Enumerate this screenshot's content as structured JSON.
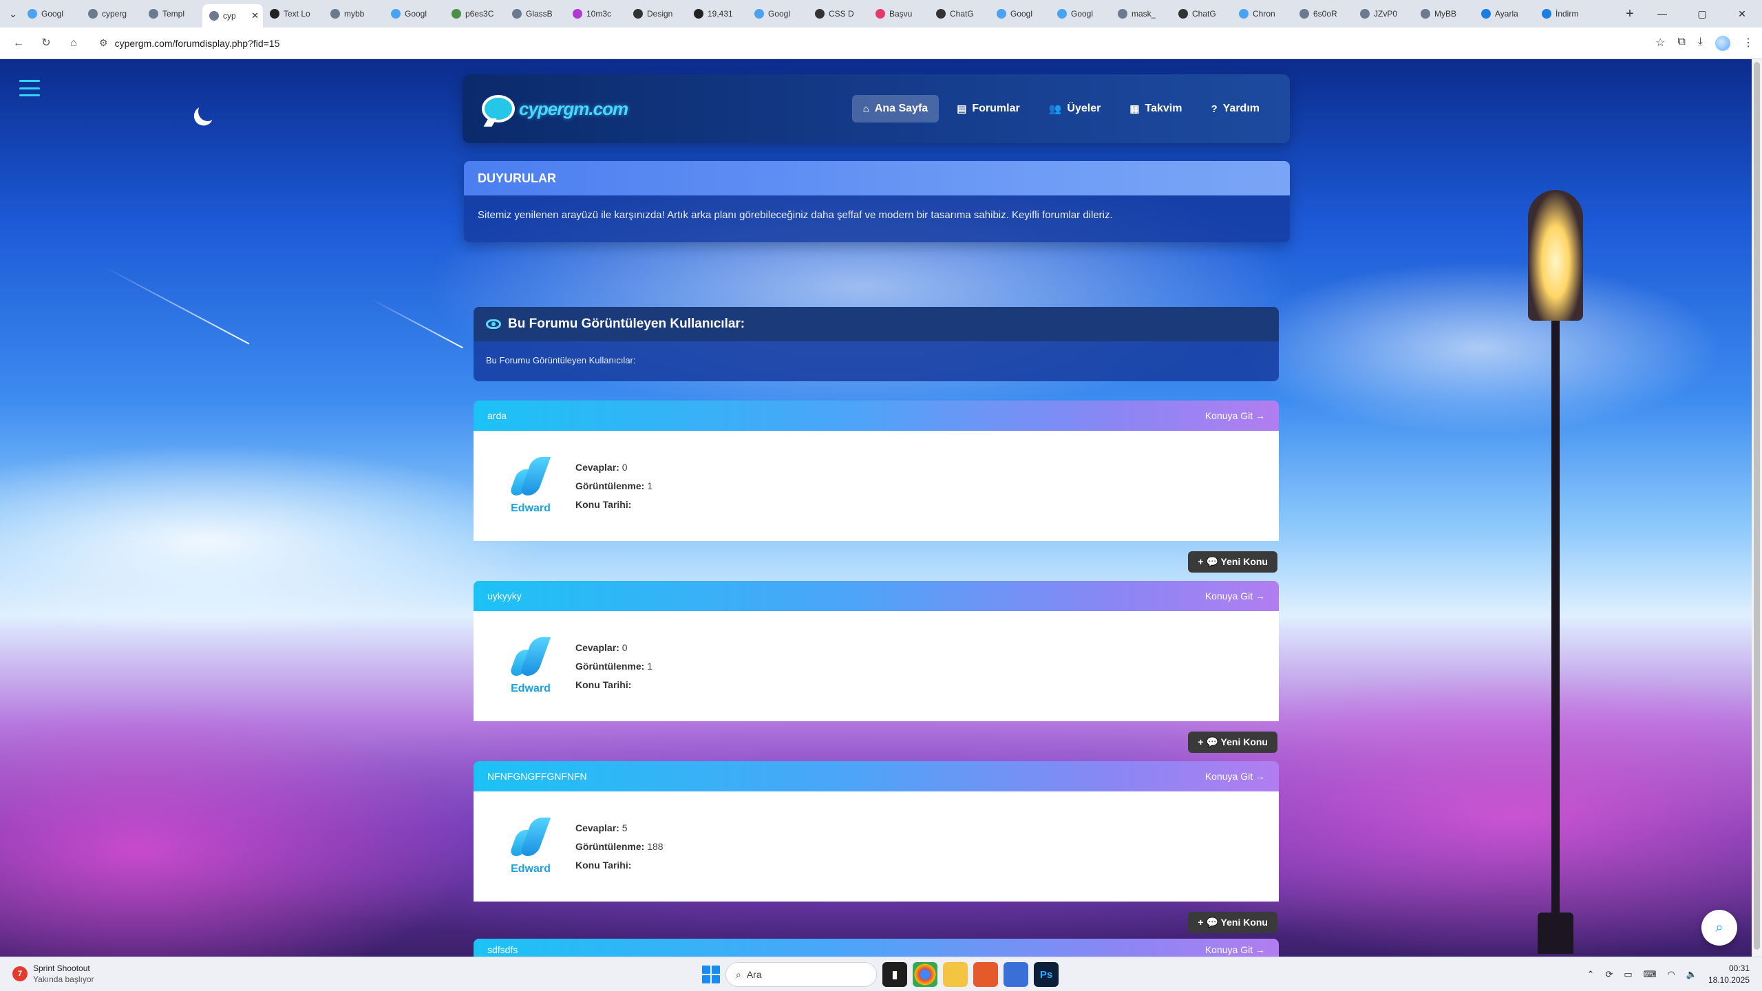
{
  "browser": {
    "tabs": [
      {
        "label": "Googl",
        "color": "#4aa3f0",
        "active": false
      },
      {
        "label": "cyperg",
        "color": "#6c7a90",
        "active": false
      },
      {
        "label": "Templ",
        "color": "#6c7a90",
        "active": false
      },
      {
        "label": "cyp",
        "color": "#6c7a90",
        "active": true
      },
      {
        "label": "Text Lo",
        "color": "#222222",
        "active": false
      },
      {
        "label": "mybb",
        "color": "#6c7a90",
        "active": false
      },
      {
        "label": "Googl",
        "color": "#4aa3f0",
        "active": false
      },
      {
        "label": "p6es3C",
        "color": "#4a8f4a",
        "active": false
      },
      {
        "label": "GlassB",
        "color": "#6c7a90",
        "active": false
      },
      {
        "label": "10m3c",
        "color": "#b03ad0",
        "active": false
      },
      {
        "label": "Design",
        "color": "#333333",
        "active": false
      },
      {
        "label": "19,431",
        "color": "#222222",
        "active": false
      },
      {
        "label": "Googl",
        "color": "#4aa3f0",
        "active": false
      },
      {
        "label": "CSS D",
        "color": "#333333",
        "active": false
      },
      {
        "label": "Başvu",
        "color": "#e33a6a",
        "active": false
      },
      {
        "label": "ChatG",
        "color": "#333333",
        "active": false
      },
      {
        "label": "Googl",
        "color": "#4aa3f0",
        "active": false
      },
      {
        "label": "Googl",
        "color": "#4aa3f0",
        "active": false
      },
      {
        "label": "mask_",
        "color": "#6c7a90",
        "active": false
      },
      {
        "label": "ChatG",
        "color": "#333333",
        "active": false
      },
      {
        "label": "Chron",
        "color": "#4aa3f0",
        "active": false
      },
      {
        "label": "6s0oR",
        "color": "#6c7a90",
        "active": false
      },
      {
        "label": "JZvP0",
        "color": "#6c7a90",
        "active": false
      },
      {
        "label": "MyBB",
        "color": "#6c7a90",
        "active": false
      },
      {
        "label": "Ayarla",
        "color": "#1a7de0",
        "active": false
      },
      {
        "label": "İndirm",
        "color": "#1a7de0",
        "active": false
      }
    ],
    "url": "cypergm.com/forumdisplay.php?fid=15"
  },
  "site": {
    "logo_text": "cypergm.com",
    "nav": [
      {
        "label": "Ana Sayfa",
        "icon": "home-icon",
        "glyph": "⌂",
        "active": true
      },
      {
        "label": "Forumlar",
        "icon": "forums-icon",
        "glyph": "▤",
        "active": false
      },
      {
        "label": "Üyeler",
        "icon": "members-icon",
        "glyph": "👥",
        "active": false
      },
      {
        "label": "Takvim",
        "icon": "calendar-icon",
        "glyph": "▦",
        "active": false
      },
      {
        "label": "Yardım",
        "icon": "help-icon",
        "glyph": "?",
        "active": false
      }
    ]
  },
  "announcement": {
    "title": "DUYURULAR",
    "text": "Sitemiz yenilenen arayüzü ile karşınızda! Artık arka planı görebileceğiniz daha şeffaf ve modern bir tasarıma sahibiz. Keyifli forumlar dileriz."
  },
  "viewers": {
    "title": "Bu Forumu Görüntüleyen Kullanıcılar:",
    "text": "Bu Forumu Görüntüleyen Kullanıcılar:"
  },
  "labels": {
    "goto": "Konuya Git →",
    "replies": "Cevaplar:",
    "views": "Görüntülenme:",
    "date": "Konu Tarihi:",
    "new_topic": "+ 💬 Yeni Konu"
  },
  "threads": [
    {
      "title": "arda",
      "author": "Edward",
      "replies": "0",
      "views": "1",
      "date": ""
    },
    {
      "title": "uykyyky",
      "author": "Edward",
      "replies": "0",
      "views": "1",
      "date": ""
    },
    {
      "title": "NFNFGNGFFGNFNFN",
      "author": "Edward",
      "replies": "5",
      "views": "188",
      "date": ""
    }
  ],
  "partial_thread": {
    "title": "sdfsdfs"
  },
  "taskbar": {
    "news_title": "Sprint Shootout",
    "news_sub": "Yakında başlıyor",
    "news_badge": "7",
    "search_placeholder": "Ara",
    "time": "00:31",
    "date": "18.10.2025"
  }
}
